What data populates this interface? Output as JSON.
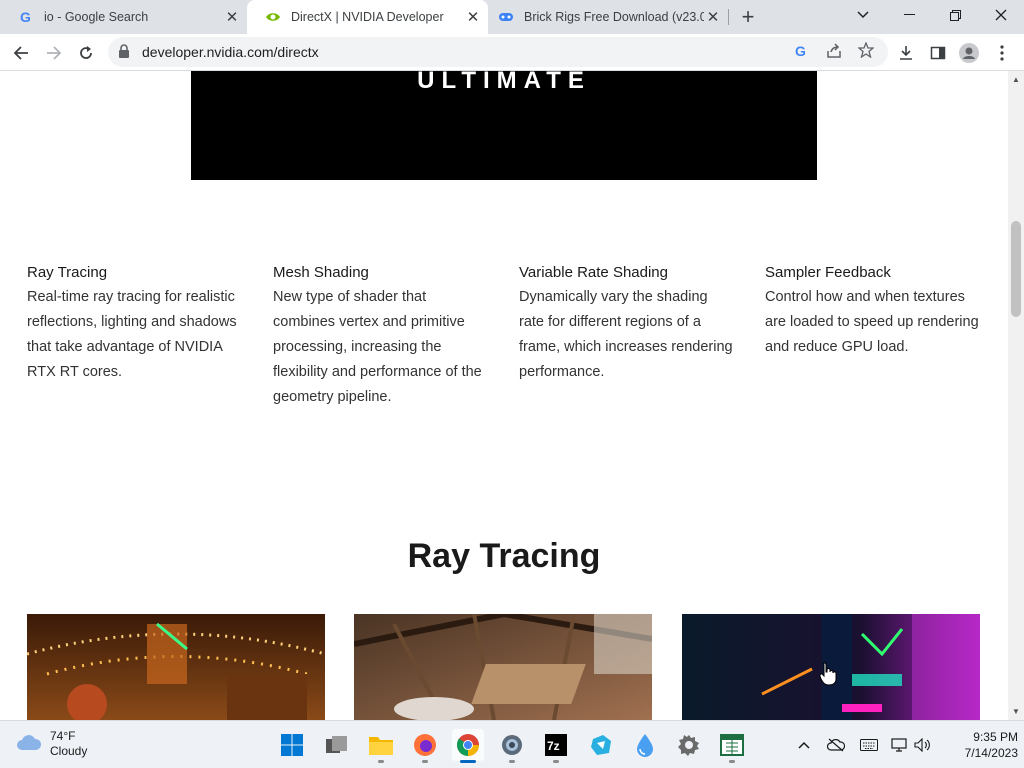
{
  "browser": {
    "tabs": [
      {
        "title": "io - Google Search",
        "favicon": "google-g-icon"
      },
      {
        "title": "DirectX | NVIDIA Developer",
        "favicon": "nvidia-icon",
        "active": true
      },
      {
        "title": "Brick Rigs Free Download (v23.0",
        "favicon": "gamepad-icon"
      }
    ],
    "url": "developer.nvidia.com/directx"
  },
  "page": {
    "hero_text": "ULTIMATE",
    "features": [
      {
        "title": "Ray Tracing",
        "desc": "Real-time ray tracing for realistic reflections, lighting and shadows that take advantage of NVIDIA RTX RT cores."
      },
      {
        "title": "Mesh Shading",
        "desc": "New type of shader that combines vertex and primitive processing, increasing the flexibility and performance of the geometry pipeline."
      },
      {
        "title": "Variable Rate Shading",
        "desc": "Dynamically vary the shading rate for different regions of a frame, which increases rendering performance."
      },
      {
        "title": "Sampler Feedback",
        "desc": "Control how and when textures are loaded to speed up rendering and reduce GPU load."
      }
    ],
    "section_title": "Ray Tracing",
    "thumbnails": [
      "carousel-scene-image",
      "attic-scene-image",
      "neon-city-scene-image"
    ]
  },
  "taskbar": {
    "weather": {
      "temp": "74°F",
      "condition": "Cloudy"
    },
    "clock": {
      "time": "9:35 PM",
      "date": "7/14/2023"
    },
    "apps": [
      "windows-start-icon",
      "task-view-icon",
      "file-explorer-icon",
      "firefox-icon",
      "chrome-icon",
      "settings-gear-icon",
      "7zip-icon",
      "app-icon",
      "droplet-icon",
      "settings-icon",
      "spreadsheet-icon"
    ]
  },
  "colors": {
    "nvidia_green": "#76b900",
    "accent_blue": "#0067c0"
  }
}
